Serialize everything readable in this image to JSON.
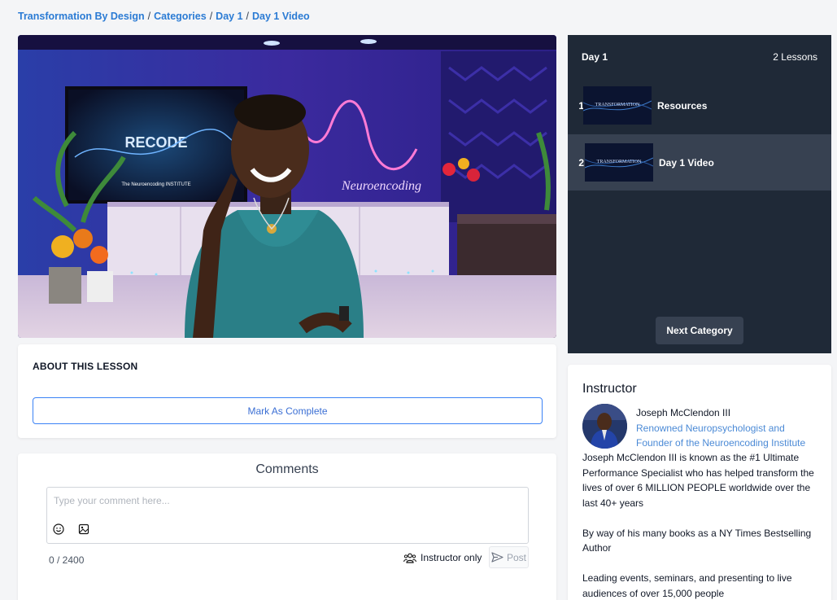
{
  "breadcrumb": {
    "items": [
      "Transformation By Design",
      "Categories",
      "Day 1",
      "Day 1 Video"
    ],
    "separator": "/"
  },
  "about": {
    "title": "ABOUT THIS LESSON",
    "complete_label": "Mark As Complete"
  },
  "comments": {
    "heading": "Comments",
    "placeholder": "Type your comment here...",
    "counter": "0 / 2400",
    "instructor_only_label": "Instructor only",
    "post_label": "Post"
  },
  "lessons": {
    "title": "Day 1",
    "count": "2 Lessons",
    "items": [
      {
        "number": "1",
        "name": "Resources",
        "active": false
      },
      {
        "number": "2",
        "name": "Day 1 Video",
        "active": true
      }
    ],
    "next_label": "Next Category"
  },
  "instructor": {
    "heading": "Instructor",
    "name": "Joseph McClendon III",
    "role": "Renowned Neuropsychologist and Founder of the Neuroencoding Institute",
    "bio": [
      "Joseph McClendon III is known as the #1 Ultimate Performance Specialist who has helped transform the lives of over 6 MILLION PEOPLE worldwide over the last 40+ years",
      "By way of his many books as a NY Times Bestselling Author",
      "Leading events, seminars, and presenting to live audiences of over 15,000 people"
    ]
  },
  "colors": {
    "accent": "#2b7bd4",
    "sidebar_bg": "#1f2937",
    "sidebar_active": "#374151"
  }
}
